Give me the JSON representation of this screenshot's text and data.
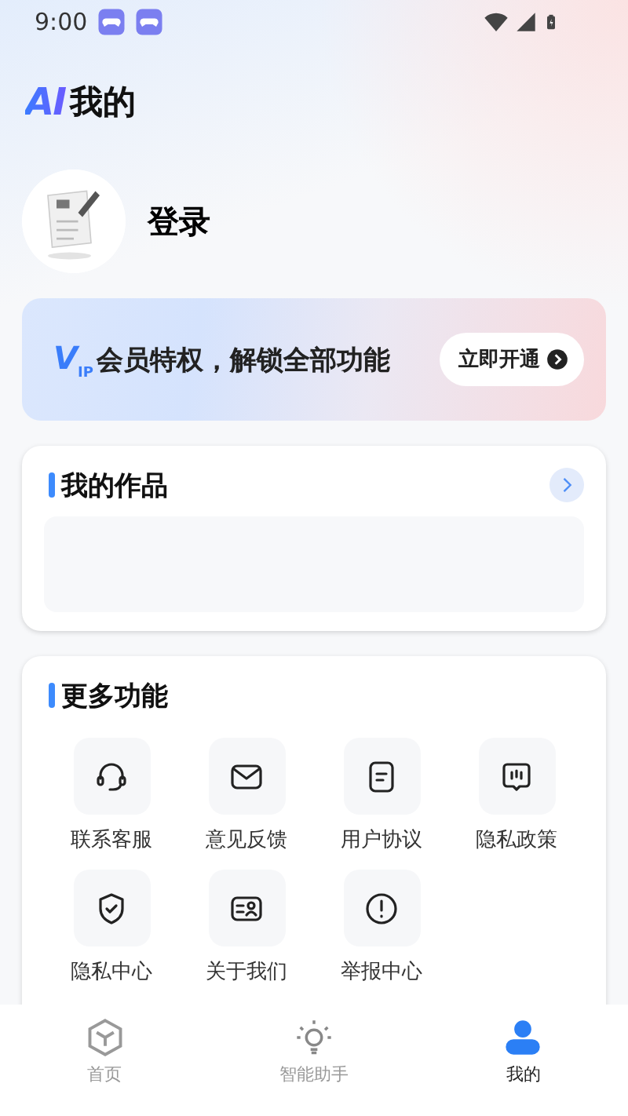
{
  "status_bar": {
    "time": "9:00"
  },
  "header": {
    "logo": "AI",
    "title": "我的"
  },
  "profile": {
    "login": "登录"
  },
  "vip_banner": {
    "badge": "V$_{IP}$",
    "text": "会员特权，解锁全部功能",
    "button": "立即开通"
  },
  "works": {
    "title": "我的作品"
  },
  "more": {
    "title": "更多功能",
    "items": [
      {
        "label": "联系客服"
      },
      {
        "label": "意见反馈"
      },
      {
        "label": "用户协议"
      },
      {
        "label": "隐私政策"
      },
      {
        "label": "隐私中心"
      },
      {
        "label": "关于我们"
      },
      {
        "label": "举报中心"
      }
    ]
  },
  "tabs": [
    {
      "label": "首页",
      "selected": false
    },
    {
      "label": "智能助手",
      "selected": false
    },
    {
      "label": "我的",
      "selected": true
    }
  ]
}
